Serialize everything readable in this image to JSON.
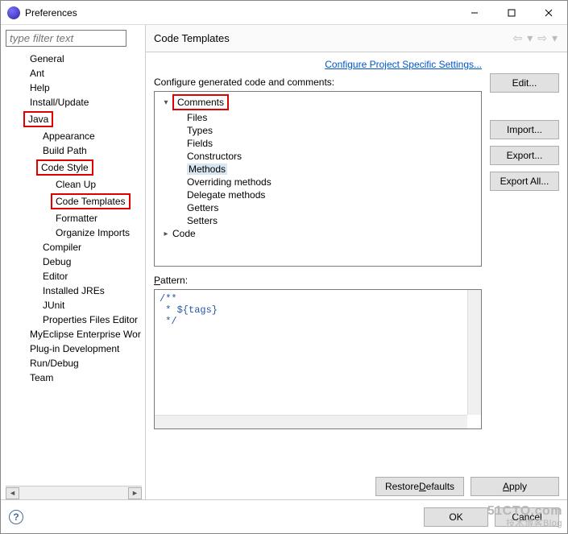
{
  "window": {
    "title": "Preferences"
  },
  "filter_placeholder": "type filter text",
  "tree": {
    "items": [
      "General",
      "Ant",
      "Help",
      "Install/Update",
      "Java",
      "Appearance",
      "Build Path",
      "Code Style",
      "Clean Up",
      "Code Templates",
      "Formatter",
      "Organize Imports",
      "Compiler",
      "Debug",
      "Editor",
      "Installed JREs",
      "JUnit",
      "Properties Files Editor",
      "MyEclipse Enterprise Wor",
      "Plug-in Development",
      "Run/Debug",
      "Team"
    ]
  },
  "content": {
    "title": "Code Templates",
    "project_link": "Configure Project Specific Settings...",
    "configure_label": "Configure generated code and comments:",
    "list": {
      "comments_label": "Comments",
      "items": [
        "Files",
        "Types",
        "Fields",
        "Constructors",
        "Methods",
        "Overriding methods",
        "Delegate methods",
        "Getters",
        "Setters"
      ],
      "code_label": "Code",
      "selected": "Methods"
    },
    "pattern_label": "Pattern:",
    "pattern_text": "/**\n * ${tags}\n */",
    "buttons": {
      "edit": "Edit...",
      "import": "Import...",
      "export": "Export...",
      "export_all": "Export All..."
    },
    "restore": "Restore Defaults",
    "apply": "Apply"
  },
  "footer": {
    "ok": "OK",
    "cancel": "Cancel"
  },
  "watermark": {
    "main": "51CTO.com",
    "sub": "技术博客Blog"
  }
}
